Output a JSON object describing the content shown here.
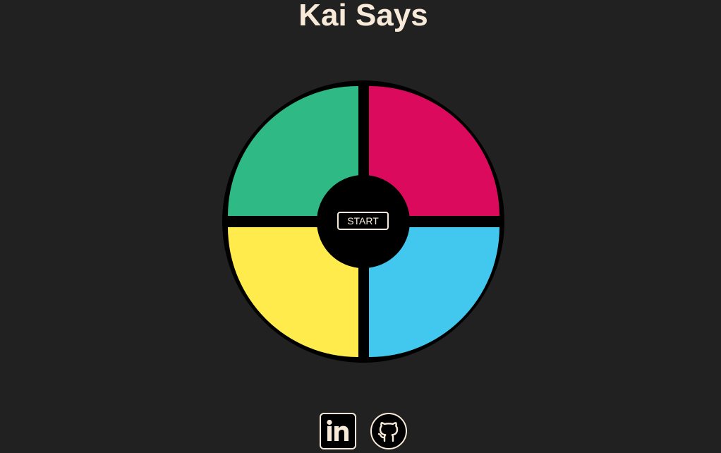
{
  "header": {
    "title": "Kai Says"
  },
  "game": {
    "pads": [
      {
        "name": "green",
        "color": "#2fba85"
      },
      {
        "name": "red",
        "color": "#dc0a5d"
      },
      {
        "name": "yellow",
        "color": "#ffec4c"
      },
      {
        "name": "blue",
        "color": "#42c8ee"
      }
    ],
    "start_label": "START"
  },
  "footer": {
    "links": [
      {
        "icon": "linkedin-icon"
      },
      {
        "icon": "github-icon"
      }
    ]
  },
  "colors": {
    "background": "#212121",
    "text": "#f8ead8",
    "board": "#000000"
  }
}
